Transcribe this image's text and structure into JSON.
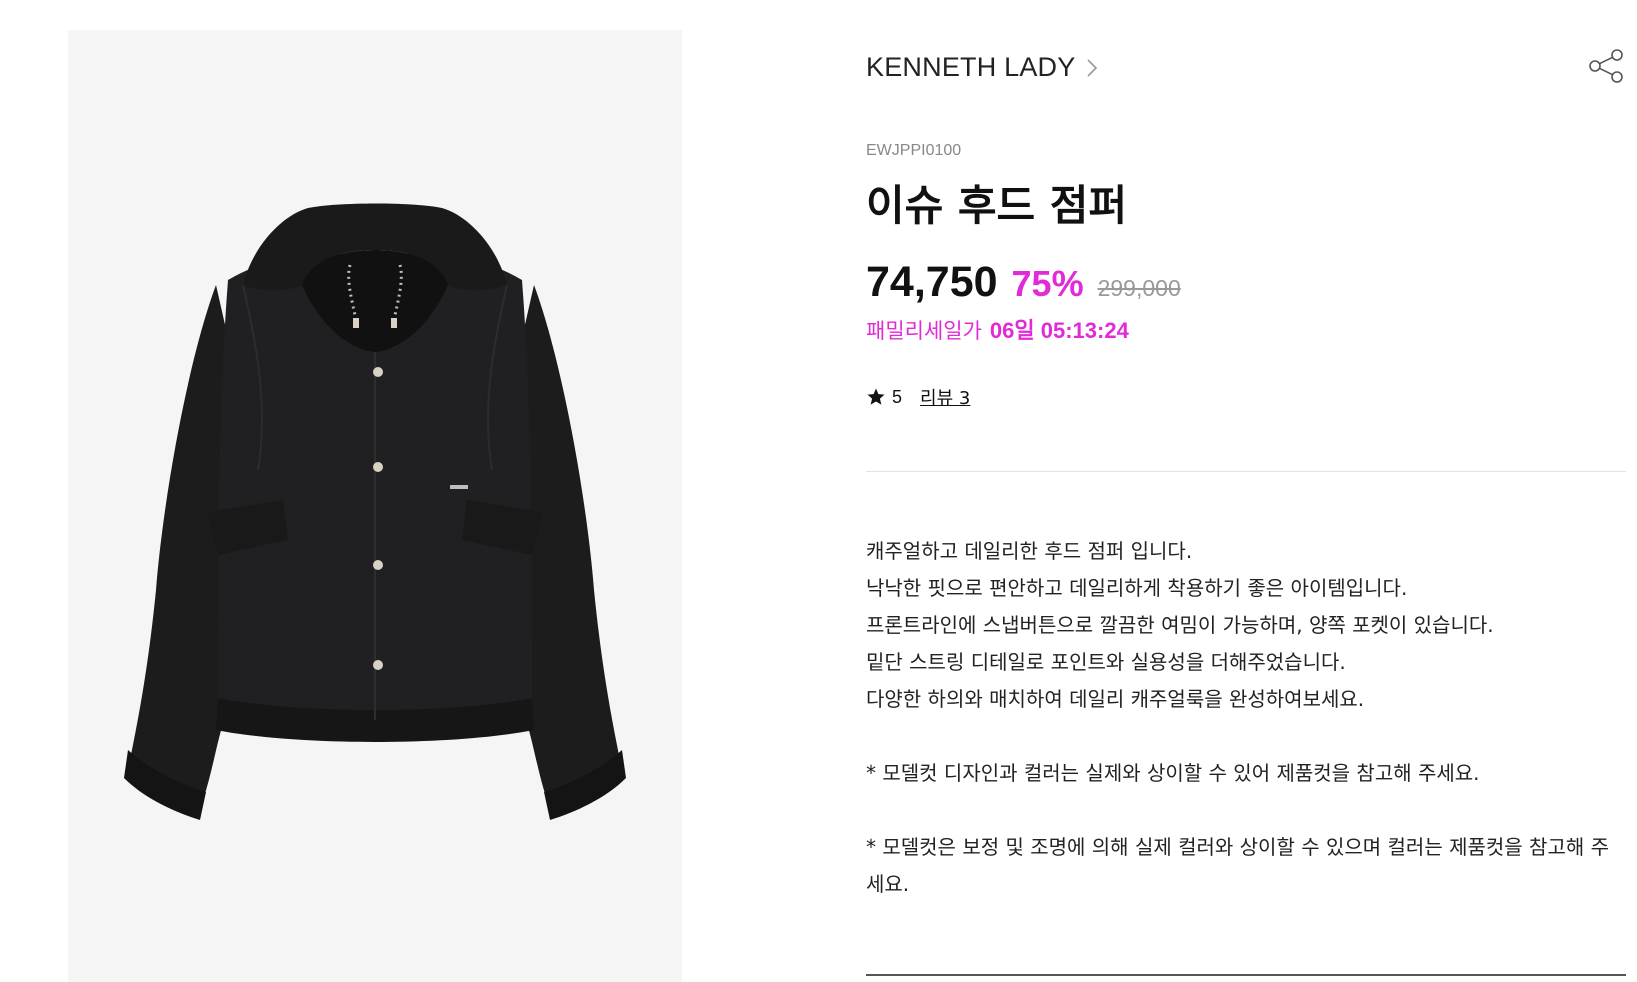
{
  "brand": {
    "name": "KENNETH LADY",
    "chevron_icon": "chevron-right-icon"
  },
  "share": {
    "icon": "share-icon"
  },
  "product": {
    "code": "EWJPPI0100",
    "title": "이슈 후드 점퍼",
    "image_alt": "black hooded jumper"
  },
  "price": {
    "sale_price": "74,750",
    "discount_rate": "75%",
    "original_price": "299,000",
    "accent_color": "#e22ad7"
  },
  "sale": {
    "label": "패밀리세일가",
    "timer": "06일 05:13:24"
  },
  "rating": {
    "icon": "star-icon",
    "value": "5",
    "review_link": "리뷰 3"
  },
  "description": {
    "lines": [
      "캐주얼하고 데일리한 후드 점퍼 입니다.",
      "낙낙한 핏으로 편안하고 데일리하게 착용하기 좋은 아이템입니다.",
      "프론트라인에 스냅버튼으로 깔끔한 여밈이 가능하며, 양쪽 포켓이 있습니다.",
      "밑단 스트링 디테일로 포인트와 실용성을 더해주었습니다.",
      "다양한 하의와 매치하여 데일리 캐주얼룩을 완성하여보세요."
    ],
    "note_1": "* 모델컷 디자인과 컬러는 실제와 상이할 수 있어 제품컷을 참고해 주세요.",
    "note_2": "* 모델컷은 보정 및 조명에 의해 실제 컬러와 상이할 수 있으며 컬러는 제품컷을 참고해 주세요."
  }
}
